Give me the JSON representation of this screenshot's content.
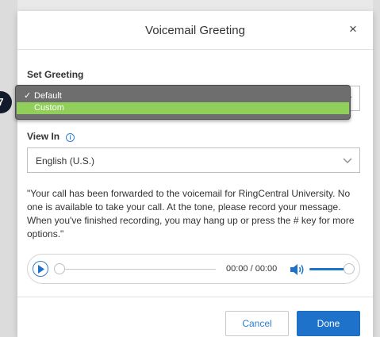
{
  "dialog": {
    "title": "Voicemail Greeting",
    "close_glyph": "×"
  },
  "set_greeting": {
    "label": "Set Greeting",
    "dropdown": {
      "options": [
        {
          "label": "Default",
          "checked": true
        },
        {
          "label": "Custom",
          "highlighted": true
        }
      ],
      "check_glyph": "✓"
    }
  },
  "step_badge": "7",
  "view_in": {
    "label": "View In",
    "info_glyph": "i",
    "selected": "English (U.S.)"
  },
  "message": "\"Your call has been forwarded to the voicemail for RingCentral University. No one is available to take your call. At the tone, please record your message. When you've finished recording, you may hang up or press the # key for more options.\"",
  "player": {
    "time": "00:00 / 00:00",
    "progress": 0,
    "volume": 1.0
  },
  "footer": {
    "cancel_label": "Cancel",
    "done_label": "Done"
  },
  "colors": {
    "accent": "#1f72c9",
    "highlight": "#8fcf5a",
    "popup_bg": "#6e6e6e",
    "badge_bg": "#121a2b"
  },
  "icons": {
    "close": "close-icon",
    "chevron": "chevron-down-icon",
    "info": "info-icon",
    "play": "play-icon",
    "volume": "volume-icon",
    "check": "check-icon"
  }
}
